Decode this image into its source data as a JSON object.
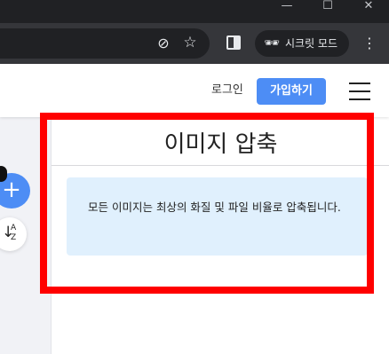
{
  "window": {
    "minimize_glyph": "—",
    "maximize_glyph": "☐",
    "close_glyph": "✕"
  },
  "toolbar": {
    "icons": [
      "eye-off-icon",
      "star-icon",
      "side-panel-icon",
      "incognito-icon",
      "kebab-menu-icon"
    ],
    "incognito_label": "시크릿 모드"
  },
  "header": {
    "login_label": "로그인",
    "signup_label": "가입하기",
    "accent_color": "#4d8df5"
  },
  "sidebar": {
    "plus_glyph": "+",
    "sort_arrow_glyph": "↓",
    "sort_az_label": "A\nZ"
  },
  "main": {
    "title": "이미지 압축",
    "info_text": "모든 이미지는 최상의 화질 및 파일 비율로 압축됩니다.",
    "info_bg_color": "#e0f0fd"
  },
  "annotation": {
    "color": "#ff0000"
  }
}
